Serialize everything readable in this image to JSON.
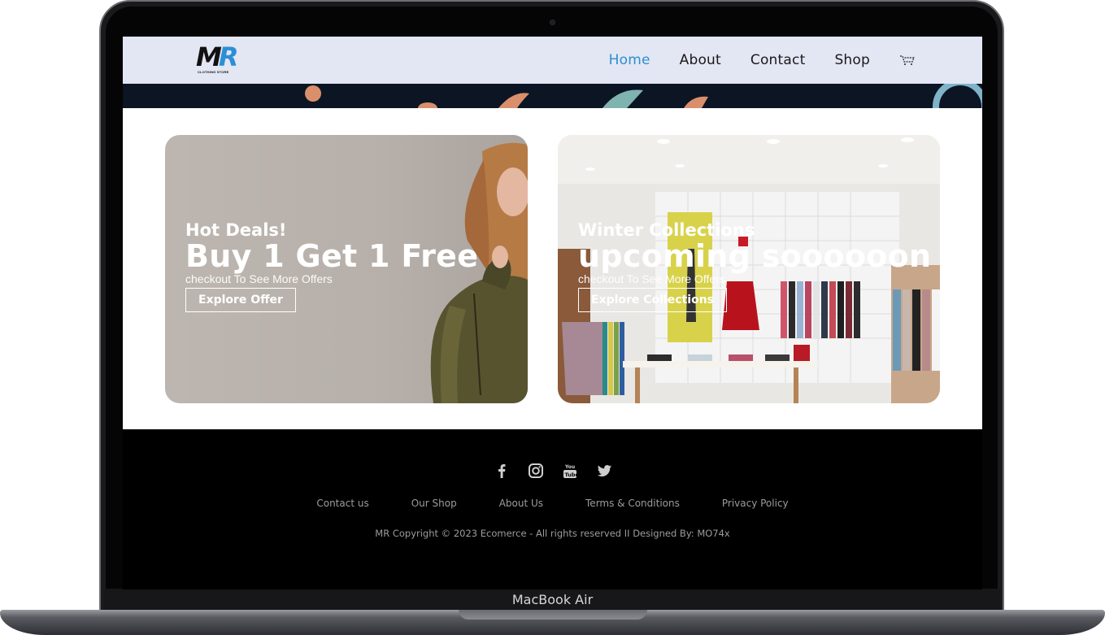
{
  "device": {
    "label": "MacBook Air"
  },
  "brand": {
    "logo_text": "MR",
    "logo_sub": "CLOTHING STORE"
  },
  "nav": {
    "items": [
      {
        "label": "Home",
        "active": true
      },
      {
        "label": "About",
        "active": false
      },
      {
        "label": "Contact",
        "active": false
      },
      {
        "label": "Shop",
        "active": false
      }
    ],
    "cart_icon": "cart-icon"
  },
  "banners": [
    {
      "kicker": "Hot Deals!",
      "headline": "Buy 1 Get 1 Free",
      "subtext": "checkout To See More Offers",
      "button": "Explore Offer"
    },
    {
      "kicker": "Winter Collections",
      "headline": "upcoming soooooon",
      "subtext": "checkout To See More Offers",
      "button": "Explore Collections"
    }
  ],
  "footer": {
    "socials": [
      "facebook-icon",
      "instagram-icon",
      "youtube-icon",
      "twitter-icon"
    ],
    "links": [
      "Contact us",
      "Our Shop",
      "About Us",
      "Terms & Conditions",
      "Privacy Policy"
    ],
    "copyright": "MR Copyright © 2023 Ecomerce - All rights reserved II Designed By: MO74x"
  },
  "colors": {
    "nav_bg": "#e3e6f3",
    "accent": "#2d8fd0",
    "footer_text": "#9c9c9c"
  }
}
